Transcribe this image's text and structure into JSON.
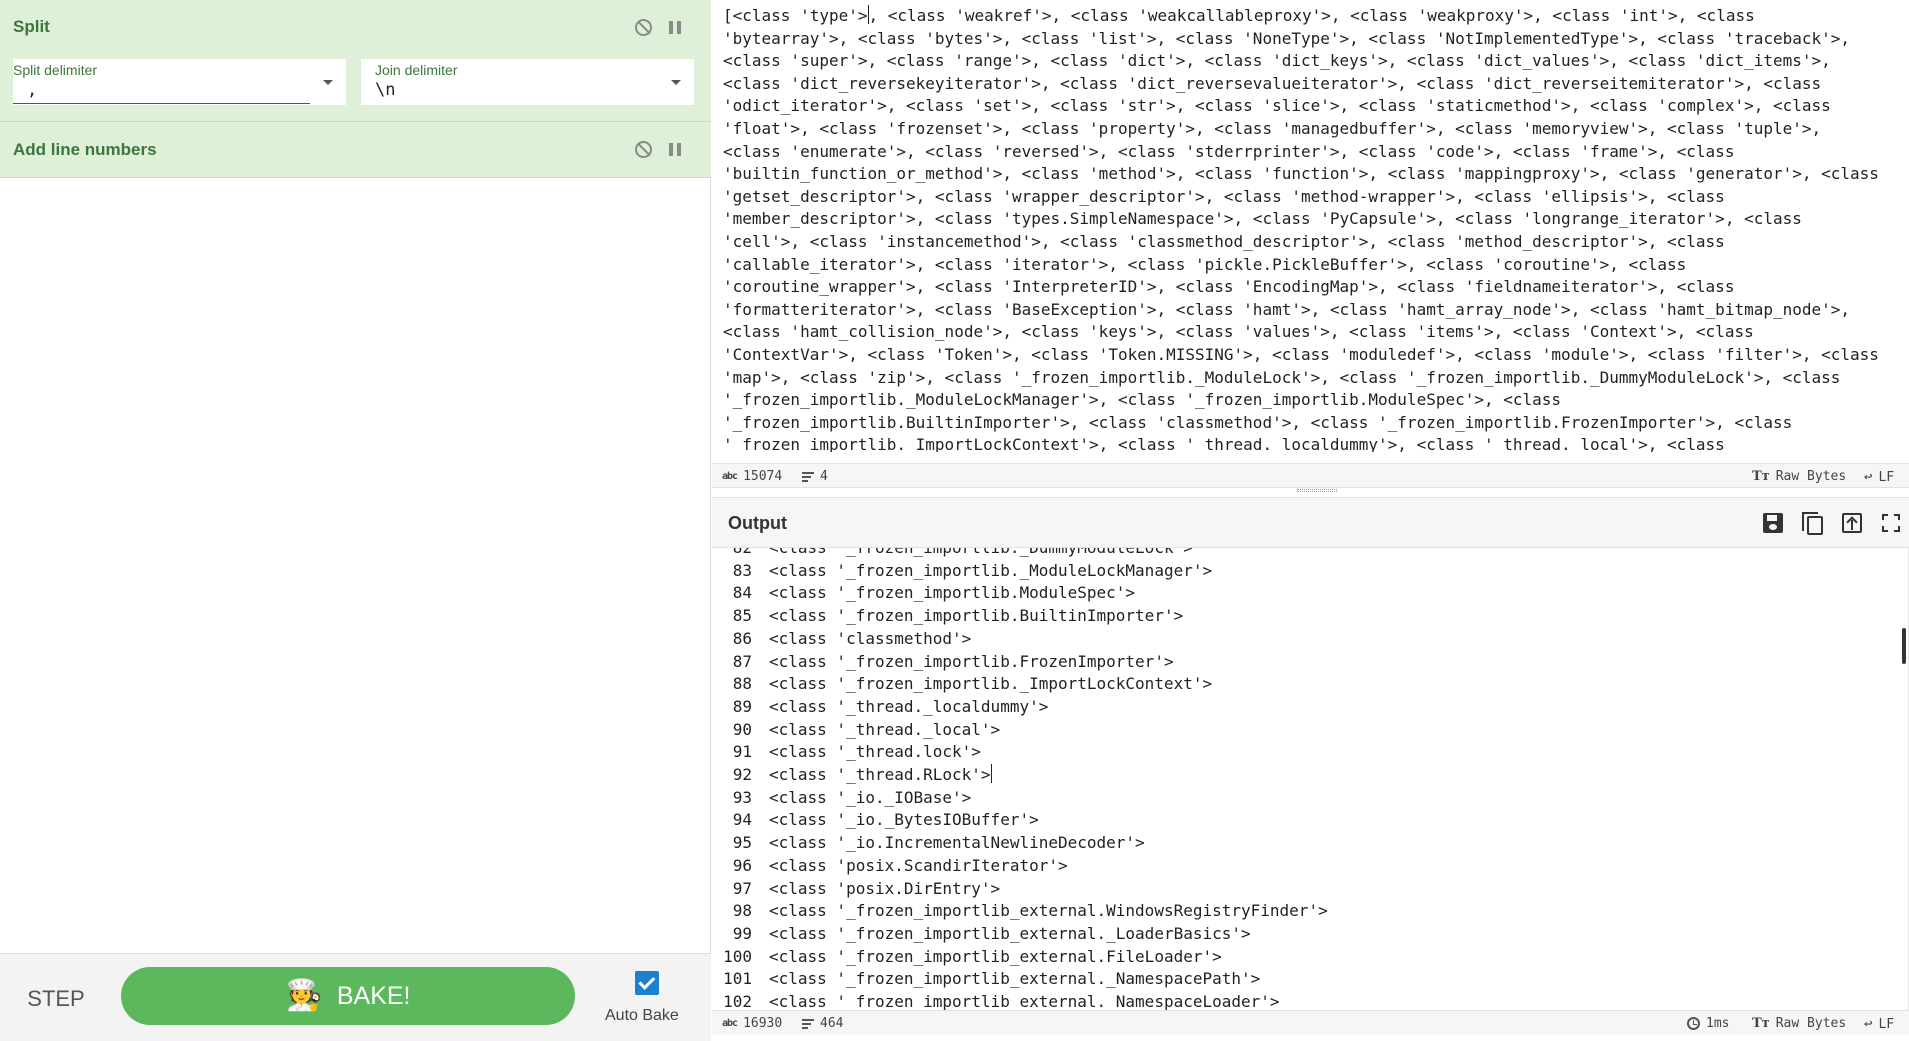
{
  "recipe": {
    "split": {
      "title": "Split",
      "split_delimiter_label": "Split delimiter",
      "split_delimiter_value": ",",
      "join_delimiter_label": "Join delimiter",
      "join_delimiter_value": "\\n"
    },
    "line_numbers": {
      "title": "Add line numbers"
    }
  },
  "bake": {
    "step_label": "STEP",
    "bake_label": "BAKE!",
    "auto_bake_label": "Auto Bake",
    "auto_bake_checked": true
  },
  "input": {
    "text_before_cursor": "[<class 'type'>",
    "text_after_cursor": ", <class 'weakref'>, <class 'weakcallableproxy'>, <class 'weakproxy'>, <class 'int'>, <class",
    "lines": [
      "'bytearray'>, <class 'bytes'>, <class 'list'>, <class 'NoneType'>, <class 'NotImplementedType'>, <class 'traceback'>,",
      "<class 'super'>, <class 'range'>, <class 'dict'>, <class 'dict_keys'>, <class 'dict_values'>, <class 'dict_items'>,",
      "<class 'dict_reversekeyiterator'>, <class 'dict_reversevalueiterator'>, <class 'dict_reverseitemiterator'>, <class",
      "'odict_iterator'>, <class 'set'>, <class 'str'>, <class 'slice'>, <class 'staticmethod'>, <class 'complex'>, <class",
      "'float'>, <class 'frozenset'>, <class 'property'>, <class 'managedbuffer'>, <class 'memoryview'>, <class 'tuple'>,",
      "<class 'enumerate'>, <class 'reversed'>, <class 'stderrprinter'>, <class 'code'>, <class 'frame'>, <class",
      "'builtin_function_or_method'>, <class 'method'>, <class 'function'>, <class 'mappingproxy'>, <class 'generator'>, <class",
      "'getset_descriptor'>, <class 'wrapper_descriptor'>, <class 'method-wrapper'>, <class 'ellipsis'>, <class",
      "'member_descriptor'>, <class 'types.SimpleNamespace'>, <class 'PyCapsule'>, <class 'longrange_iterator'>, <class",
      "'cell'>, <class 'instancemethod'>, <class 'classmethod_descriptor'>, <class 'method_descriptor'>, <class",
      "'callable_iterator'>, <class 'iterator'>, <class 'pickle.PickleBuffer'>, <class 'coroutine'>, <class",
      "'coroutine_wrapper'>, <class 'InterpreterID'>, <class 'EncodingMap'>, <class 'fieldnameiterator'>, <class",
      "'formatteriterator'>, <class 'BaseException'>, <class 'hamt'>, <class 'hamt_array_node'>, <class 'hamt_bitmap_node'>,",
      "<class 'hamt_collision_node'>, <class 'keys'>, <class 'values'>, <class 'items'>, <class 'Context'>, <class",
      "'ContextVar'>, <class 'Token'>, <class 'Token.MISSING'>, <class 'moduledef'>, <class 'module'>, <class 'filter'>, <class",
      "'map'>, <class 'zip'>, <class '_frozen_importlib._ModuleLock'>, <class '_frozen_importlib._DummyModuleLock'>, <class",
      "'_frozen_importlib._ModuleLockManager'>, <class '_frozen_importlib.ModuleSpec'>, <class",
      "'_frozen_importlib.BuiltinImporter'>, <class 'classmethod'>, <class '_frozen_importlib.FrozenImporter'>, <class",
      "'_frozen_importlib._ImportLockContext'>, <class '_thread._localdummy'>, <class '_thread._local'>, <class"
    ],
    "status": {
      "chars": "15074",
      "lines": "4",
      "encoding": "Raw Bytes",
      "eol": "LF"
    }
  },
  "output": {
    "title": "Output",
    "partial_top_line": {
      "num": "82",
      "text": "<class '_frozen_importlib._DummyModuleLock'>"
    },
    "lines": [
      {
        "num": "83",
        "text": "<class '_frozen_importlib._ModuleLockManager'>"
      },
      {
        "num": "84",
        "text": "<class '_frozen_importlib.ModuleSpec'>"
      },
      {
        "num": "85",
        "text": "<class '_frozen_importlib.BuiltinImporter'>"
      },
      {
        "num": "86",
        "text": "<class 'classmethod'>"
      },
      {
        "num": "87",
        "text": "<class '_frozen_importlib.FrozenImporter'>"
      },
      {
        "num": "88",
        "text": "<class '_frozen_importlib._ImportLockContext'>"
      },
      {
        "num": "89",
        "text": "<class '_thread._localdummy'>"
      },
      {
        "num": "90",
        "text": "<class '_thread._local'>"
      },
      {
        "num": "91",
        "text": "<class '_thread.lock'>"
      },
      {
        "num": "92",
        "text": "<class '_thread.RLock'>"
      },
      {
        "num": "93",
        "text": "<class '_io._IOBase'>"
      },
      {
        "num": "94",
        "text": "<class '_io._BytesIOBuffer'>"
      },
      {
        "num": "95",
        "text": "<class '_io.IncrementalNewlineDecoder'>"
      },
      {
        "num": "96",
        "text": "<class 'posix.ScandirIterator'>"
      },
      {
        "num": "97",
        "text": "<class 'posix.DirEntry'>"
      },
      {
        "num": "98",
        "text": "<class '_frozen_importlib_external.WindowsRegistryFinder'>"
      },
      {
        "num": "99",
        "text": "<class '_frozen_importlib_external._LoaderBasics'>"
      },
      {
        "num": "100",
        "text": "<class '_frozen_importlib_external.FileLoader'>"
      },
      {
        "num": "101",
        "text": "<class '_frozen_importlib_external._NamespacePath'>"
      },
      {
        "num": "102",
        "text": "<class '_frozen_importlib_external._NamespaceLoader'>"
      }
    ],
    "status": {
      "chars": "16930",
      "lines": "464",
      "time": "1ms",
      "encoding": "Raw Bytes",
      "eol": "LF"
    }
  },
  "icons": {
    "disable": "disable-icon",
    "pause": "pause-icon",
    "chef": "🧑‍🍳",
    "save": "save-icon",
    "copy": "copy-icon",
    "replace_input": "move-to-input-icon",
    "maximise": "maximise-icon"
  }
}
